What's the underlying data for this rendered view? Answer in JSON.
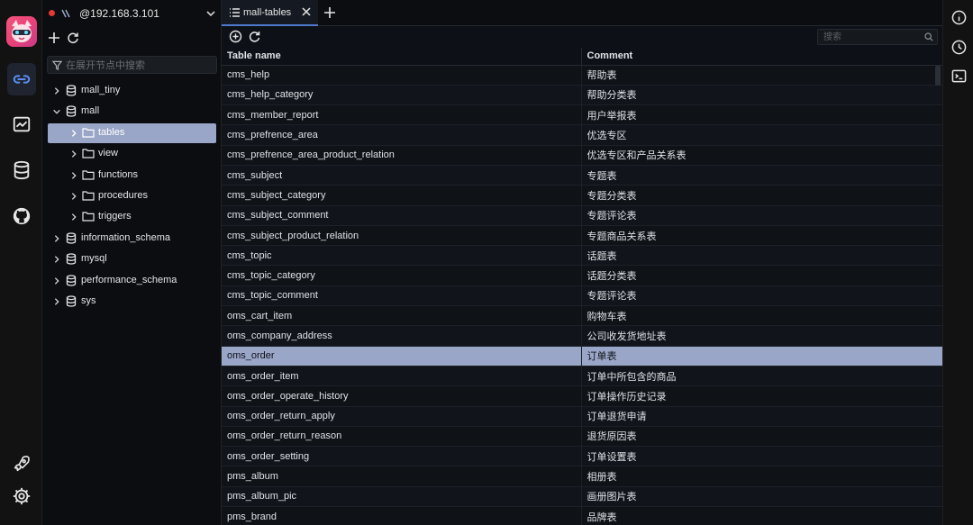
{
  "connection": {
    "host": "@192.168.3.101",
    "status_color": "#e53935"
  },
  "sidebar": {
    "filter_placeholder": "在展开节点中搜索",
    "tree": [
      {
        "label": "mall_tiny",
        "type": "database",
        "expanded": false,
        "level": 0
      },
      {
        "label": "mall",
        "type": "database",
        "expanded": true,
        "level": 0
      },
      {
        "label": "tables",
        "type": "folder",
        "expanded": false,
        "level": 1,
        "selected": true
      },
      {
        "label": "view",
        "type": "folder",
        "expanded": false,
        "level": 1
      },
      {
        "label": "functions",
        "type": "folder",
        "expanded": false,
        "level": 1
      },
      {
        "label": "procedures",
        "type": "folder",
        "expanded": false,
        "level": 1
      },
      {
        "label": "triggers",
        "type": "folder",
        "expanded": false,
        "level": 1
      },
      {
        "label": "information_schema",
        "type": "database",
        "expanded": false,
        "level": 0
      },
      {
        "label": "mysql",
        "type": "database",
        "expanded": false,
        "level": 0
      },
      {
        "label": "performance_schema",
        "type": "database",
        "expanded": false,
        "level": 0
      },
      {
        "label": "sys",
        "type": "database",
        "expanded": false,
        "level": 0
      }
    ]
  },
  "tabs": [
    {
      "label": "mall-tables",
      "active": true
    }
  ],
  "search": {
    "placeholder": "搜索"
  },
  "table": {
    "columns": [
      "Table name",
      "Comment"
    ],
    "selected_row": "oms_order",
    "rows": [
      [
        "cms_help",
        "帮助表"
      ],
      [
        "cms_help_category",
        "帮助分类表"
      ],
      [
        "cms_member_report",
        "用户举报表"
      ],
      [
        "cms_prefrence_area",
        "优选专区"
      ],
      [
        "cms_prefrence_area_product_relation",
        "优选专区和产品关系表"
      ],
      [
        "cms_subject",
        "专题表"
      ],
      [
        "cms_subject_category",
        "专题分类表"
      ],
      [
        "cms_subject_comment",
        "专题评论表"
      ],
      [
        "cms_subject_product_relation",
        "专题商品关系表"
      ],
      [
        "cms_topic",
        "话题表"
      ],
      [
        "cms_topic_category",
        "话题分类表"
      ],
      [
        "cms_topic_comment",
        "专题评论表"
      ],
      [
        "oms_cart_item",
        "购物车表"
      ],
      [
        "oms_company_address",
        "公司收发货地址表"
      ],
      [
        "oms_order",
        "订单表"
      ],
      [
        "oms_order_item",
        "订单中所包含的商品"
      ],
      [
        "oms_order_operate_history",
        "订单操作历史记录"
      ],
      [
        "oms_order_return_apply",
        "订单退货申请"
      ],
      [
        "oms_order_return_reason",
        "退货原因表"
      ],
      [
        "oms_order_setting",
        "订单设置表"
      ],
      [
        "pms_album",
        "相册表"
      ],
      [
        "pms_album_pic",
        "画册图片表"
      ],
      [
        "pms_brand",
        "品牌表"
      ]
    ]
  },
  "colors": {
    "selection": "#9aa6c7",
    "accent": "#4d78cc",
    "background": "#0d1117"
  }
}
